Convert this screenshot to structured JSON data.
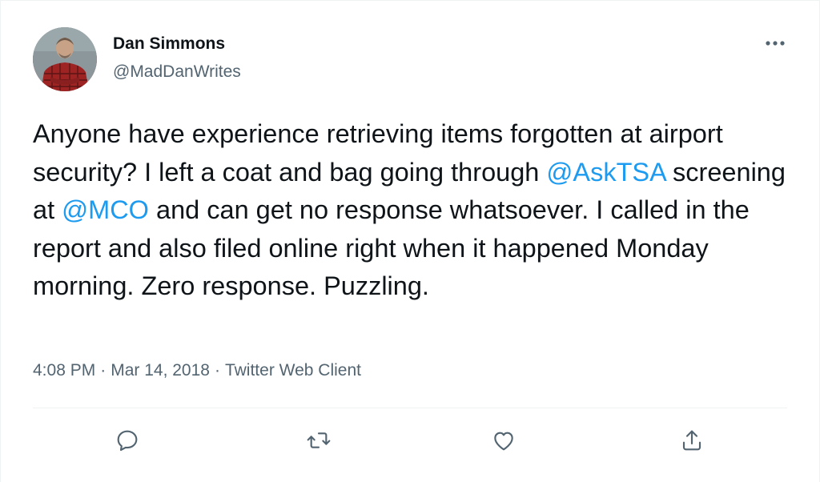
{
  "author": {
    "name": "Dan Simmons",
    "handle": "@MadDanWrites",
    "avatar_icon": "user-avatar-photo"
  },
  "tweet": {
    "segments": [
      {
        "type": "text",
        "text": "Anyone have experience retrieving items forgotten at airport security? I left a coat and bag going through "
      },
      {
        "type": "mention",
        "text": "@AskTSA"
      },
      {
        "type": "text",
        "text": " screening at "
      },
      {
        "type": "mention",
        "text": "@MCO"
      },
      {
        "type": "text",
        "text": " and can get no response whatsoever. I called in the report and also filed online right when it happened Monday morning. Zero response. Puzzling."
      }
    ]
  },
  "meta": {
    "time": "4:08 PM",
    "date": "Mar 14, 2018",
    "source": "Twitter Web Client",
    "separator": "·"
  },
  "actions": {
    "reply_icon": "reply-icon",
    "retweet_icon": "retweet-icon",
    "like_icon": "like-heart-icon",
    "share_icon": "share-icon"
  },
  "colors": {
    "text": "#0f1419",
    "secondary": "#536471",
    "link": "#1d9bf0",
    "border": "#eff3f4"
  }
}
